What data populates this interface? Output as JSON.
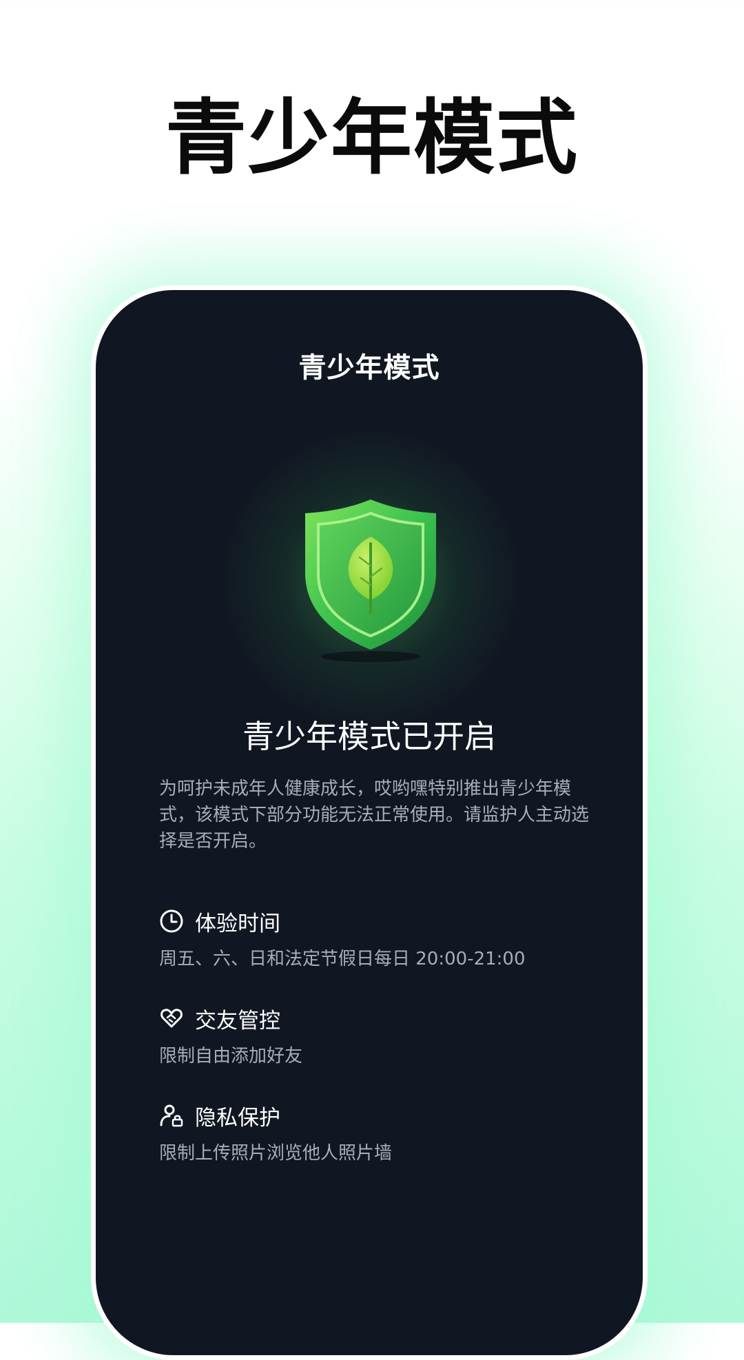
{
  "promo": {
    "title": "青少年模式"
  },
  "screen": {
    "title": "青少年模式",
    "status_title": "青少年模式已开启",
    "description": "为呵护未成年人健康成长，哎哟嘿特别推出青少年模式，该模式下部分功能无法正常使用。请监护人主动选择是否开启。",
    "features": [
      {
        "icon": "clock-icon",
        "title": "体验时间",
        "desc": "周五、六、日和法定节假日每日 20:00-21:00"
      },
      {
        "icon": "heart-handshake-icon",
        "title": "交友管控",
        "desc": "限制自由添加好友"
      },
      {
        "icon": "user-lock-icon",
        "title": "隐私保护",
        "desc": "限制上传照片浏览他人照片墙"
      }
    ]
  },
  "colors": {
    "page_bg_top": "#ffffff",
    "page_bg_bottom": "#aef8d9",
    "screen_bg": "#111722",
    "shield_green": "#3cc24f",
    "leaf_green": "#a4e44a",
    "muted_text": "#a6adbb"
  }
}
